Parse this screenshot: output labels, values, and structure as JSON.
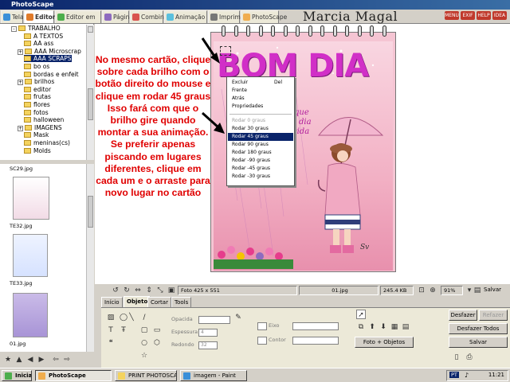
{
  "window": {
    "title": "PhotoScape"
  },
  "tabs": [
    {
      "label": "Tela",
      "color": "#3a8fd8"
    },
    {
      "label": "Editor",
      "color": "#e07b2a"
    },
    {
      "label": "Editor em lotes",
      "color": "#4cae4c"
    },
    {
      "label": "Página",
      "color": "#8e6bbf"
    },
    {
      "label": "Combine",
      "color": "#d9534f"
    },
    {
      "label": "Animação GIF",
      "color": "#5bc0de"
    },
    {
      "label": "Imprimir",
      "color": "#777777"
    },
    {
      "label": "PhotoScape",
      "color": "#f0ad4e"
    }
  ],
  "brand": {
    "text": "Marcia Magal Scraps"
  },
  "top_buttons": [
    {
      "label": "MENU",
      "color": "#c0392b"
    },
    {
      "label": "EXIF",
      "color": "#c0392b"
    },
    {
      "label": "HELP",
      "color": "#c0392b"
    },
    {
      "label": "IDEA",
      "color": "#c0392b"
    }
  ],
  "tree": {
    "items": [
      {
        "label": "TRABALHO",
        "expander": "-"
      },
      {
        "label": "A TEXTOS",
        "expander": ""
      },
      {
        "label": "AA ass",
        "expander": ""
      },
      {
        "label": "AAA Microscrap",
        "expander": "+"
      },
      {
        "label": "AAA SCRAPS",
        "expander": "",
        "selected": true
      },
      {
        "label": "bo os",
        "expander": ""
      },
      {
        "label": "bordas e enfeit",
        "expander": ""
      },
      {
        "label": "brilhos",
        "expander": "+"
      },
      {
        "label": "editor",
        "expander": ""
      },
      {
        "label": "frutas",
        "expander": ""
      },
      {
        "label": "flores",
        "expander": ""
      },
      {
        "label": "fotos",
        "expander": ""
      },
      {
        "label": "halloween",
        "expander": ""
      },
      {
        "label": "IMAGENS",
        "expander": "+"
      },
      {
        "label": "Mask",
        "expander": ""
      },
      {
        "label": "meninas(cs)",
        "expander": ""
      },
      {
        "label": "Molds",
        "expander": ""
      }
    ]
  },
  "thumbnails": [
    {
      "label": "SC29.jpg"
    },
    {
      "label": "TE32.jpg"
    },
    {
      "label": "TE33.jpg"
    },
    {
      "label": "01.jpg"
    }
  ],
  "card": {
    "title": "BOM DIA",
    "cursive_lines": [
      "que",
      "dia",
      "cida",
      "abençoada",
      "por Deus"
    ],
    "signature": "Sv"
  },
  "instructions": {
    "text": "No mesmo cartão, clique sobre cada brilho com o botão direito do mouse e clique em rodar 45 graus Isso fará com que o brilho gire quando montar a sua animação. Se preferir apenas piscando em lugares diferentes, clique em cada um e o arraste para novo lugar no cartão"
  },
  "context_menu": {
    "items": [
      {
        "label": "Excluir",
        "shortcut": "Del",
        "disabled": false
      },
      {
        "label": "Frente",
        "shortcut": "",
        "disabled": false
      },
      {
        "label": "Atrás",
        "shortcut": "",
        "disabled": false
      },
      {
        "label": "Propriedades",
        "shortcut": "",
        "disabled": false
      },
      {
        "label": "Rodar 0 graus",
        "shortcut": "",
        "disabled": true
      },
      {
        "label": "Rodar 30 graus",
        "shortcut": "",
        "disabled": false
      },
      {
        "label": "Rodar 45 graus",
        "shortcut": "",
        "disabled": false,
        "highlighted": true
      },
      {
        "label": "Rodar 90 graus",
        "shortcut": "",
        "disabled": false
      },
      {
        "label": "Rodar 180 graus",
        "shortcut": "",
        "disabled": false
      },
      {
        "label": "Rodar -90 graus",
        "shortcut": "",
        "disabled": false
      },
      {
        "label": "Rodar -45 graus",
        "shortcut": "",
        "disabled": false
      },
      {
        "label": "Rodar -30 graus",
        "shortcut": "",
        "disabled": false
      }
    ]
  },
  "status": {
    "photo_size": "Foto 425 x 551",
    "filename": "01.jpg",
    "filesize": "245.4 KB",
    "zoom": "91%",
    "save": "Salvar"
  },
  "subtabs": [
    "Início",
    "Objeto",
    "Cortar",
    "Tools"
  ],
  "active_subtab": "Objeto",
  "tool_panel": {
    "opacity_label": "Opacida",
    "thickness_label": "Espessura",
    "thickness_value": "4",
    "roundness_label": "Redondo",
    "roundness_value": "32",
    "border_label": "Eixo",
    "fill_label": "Contor",
    "photo_objects_button": "Foto + Objetos",
    "undo_button": "Desfazer",
    "redo_button": "Refazer",
    "undo_all_button": "Desfazer Todos",
    "save_button": "Salvar"
  },
  "taskbar": {
    "start": "Iniciar",
    "items": [
      {
        "label": "PhotoScape",
        "active": true,
        "color": "#f0ad4e"
      },
      {
        "label": "PRINT PHOTOSCAPE",
        "active": false,
        "color": "#f4d35e"
      },
      {
        "label": "imagem - Paint",
        "active": false,
        "color": "#3a8fd8"
      }
    ],
    "tray_lang": "PT",
    "clock": "11:21"
  }
}
